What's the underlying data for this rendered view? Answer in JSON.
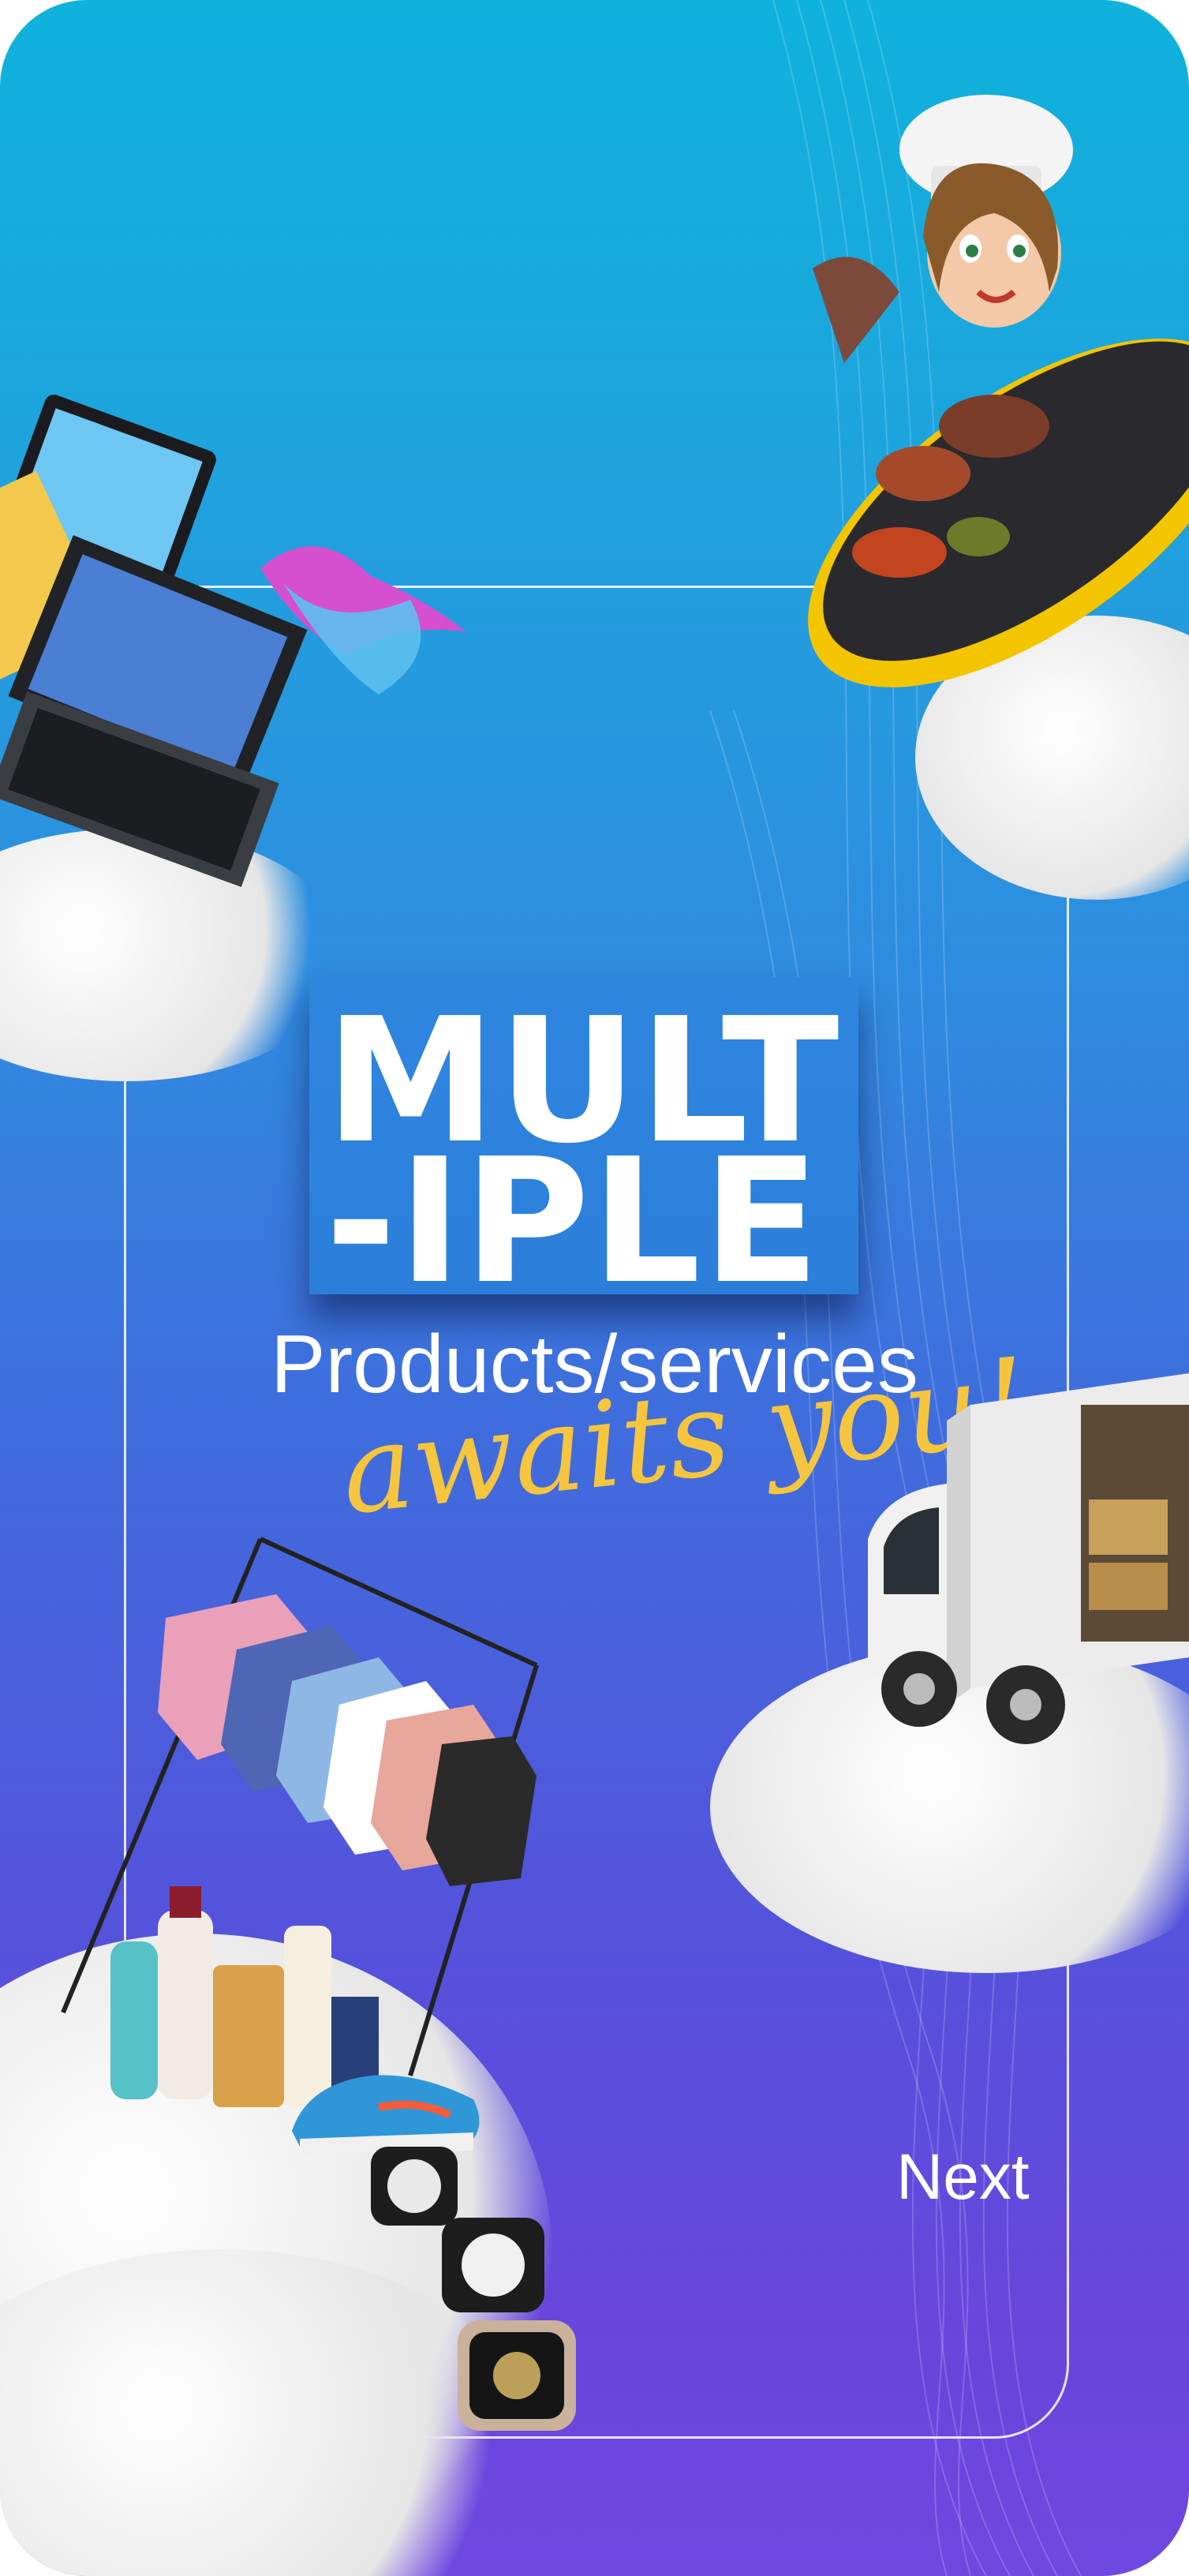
{
  "title": {
    "line1": "MULT",
    "line2": "-IPLE"
  },
  "subtitle": "Products/services",
  "tagline": "awaits you!",
  "next_label": "Next",
  "colors": {
    "gradient_top": "#0fb2dc",
    "gradient_bottom": "#6f48e0",
    "title_box": "#2f86df",
    "tagline": "#f5c53d",
    "text": "#ffffff"
  },
  "illustrations": [
    "chef-with-pan-icon",
    "laptops-tablets-icon",
    "delivery-truck-icon",
    "clothing-rack-icon",
    "cosmetics-icon",
    "sneaker-icon",
    "smartwatches-icon",
    "clouds"
  ]
}
